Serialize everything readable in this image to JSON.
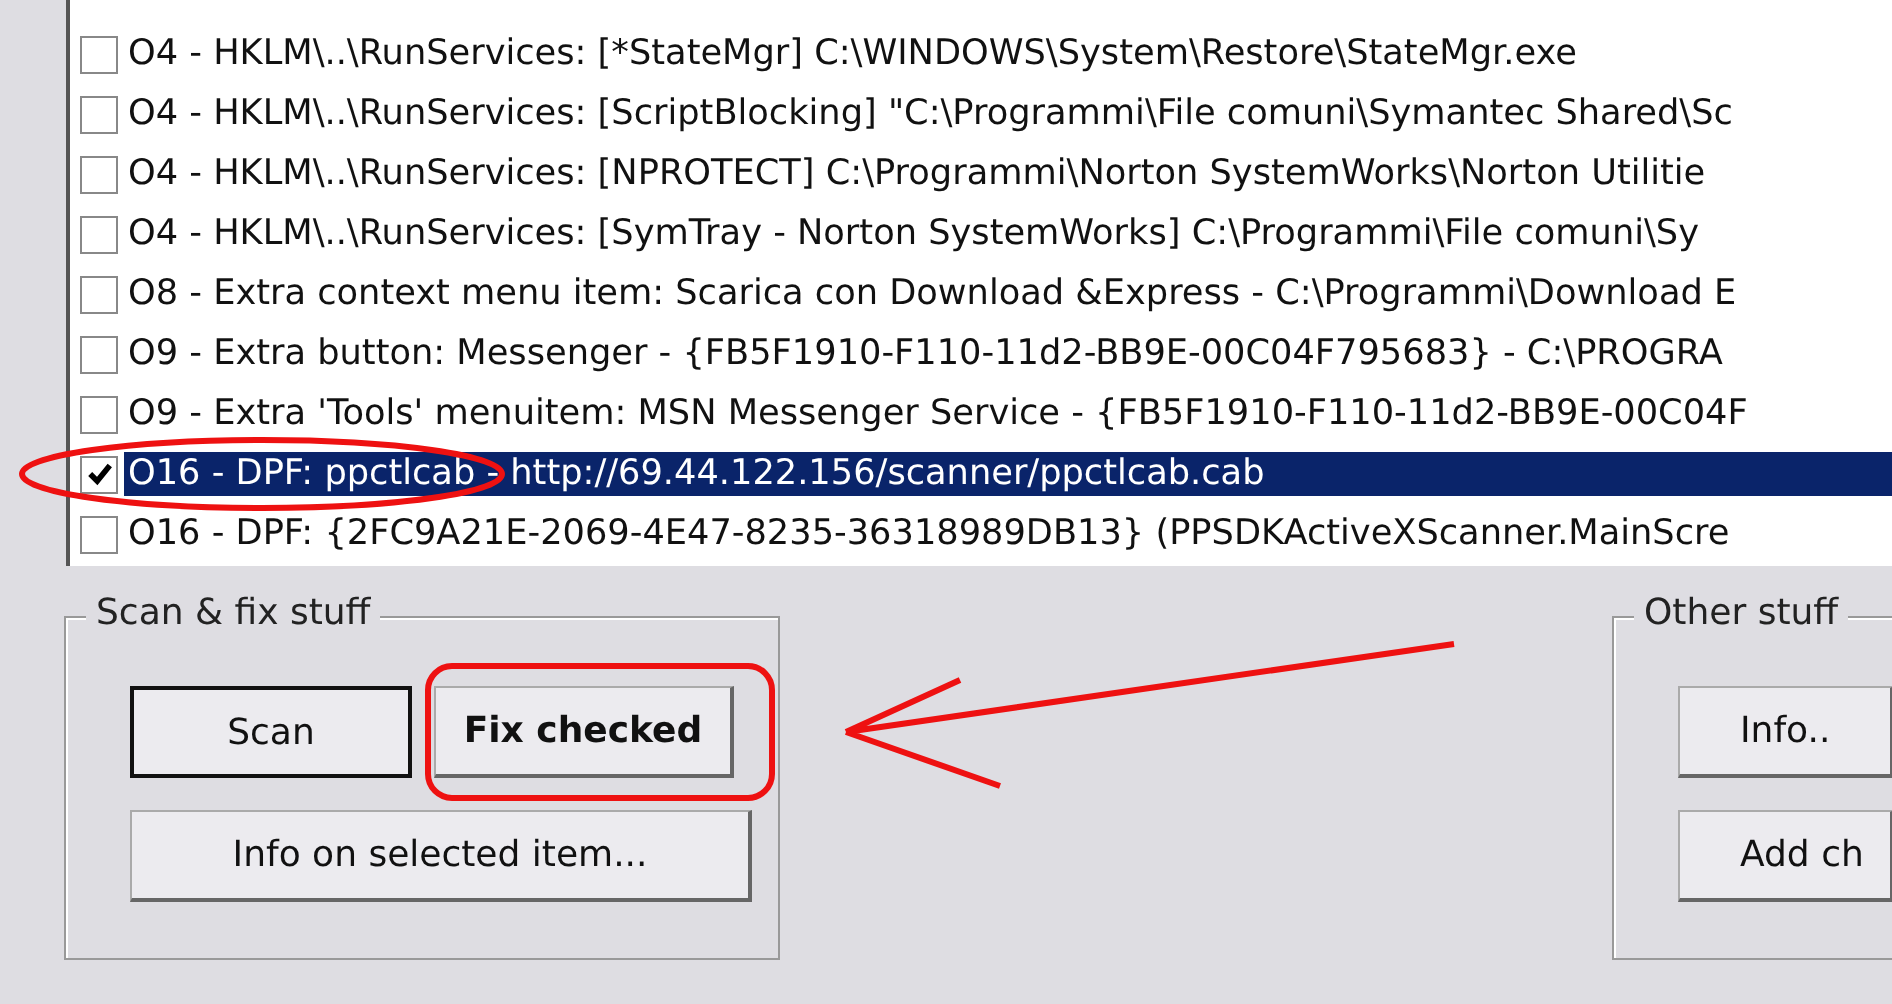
{
  "items": [
    {
      "text": "O4 - HKLM\\..\\RunServices: [*StateMgr] C:\\WINDOWS\\System\\Restore\\StateMgr.exe",
      "checked": false,
      "selected": false
    },
    {
      "text": "O4 - HKLM\\..\\RunServices: [ScriptBlocking] \"C:\\Programmi\\File comuni\\Symantec Shared\\Sc",
      "checked": false,
      "selected": false
    },
    {
      "text": "O4 - HKLM\\..\\RunServices: [NPROTECT] C:\\Programmi\\Norton SystemWorks\\Norton Utilitie",
      "checked": false,
      "selected": false
    },
    {
      "text": "O4 - HKLM\\..\\RunServices: [SymTray - Norton SystemWorks] C:\\Programmi\\File comuni\\Sy",
      "checked": false,
      "selected": false
    },
    {
      "text": "O8 - Extra context menu item: Scarica con Download &Express - C:\\Programmi\\Download E",
      "checked": false,
      "selected": false
    },
    {
      "text": "O9 - Extra button: Messenger - {FB5F1910-F110-11d2-BB9E-00C04F795683} - C:\\PROGRA",
      "checked": false,
      "selected": false
    },
    {
      "text": "O9 - Extra 'Tools' menuitem: MSN Messenger Service - {FB5F1910-F110-11d2-BB9E-00C04F",
      "checked": false,
      "selected": false
    },
    {
      "text": "O16 - DPF: ppctlcab - http://69.44.122.156/scanner/ppctlcab.cab",
      "checked": true,
      "selected": true
    },
    {
      "text": "O16 - DPF: {2FC9A21E-2069-4E47-8235-36318989DB13} (PPSDKActiveXScanner.MainScre",
      "checked": false,
      "selected": false
    }
  ],
  "groups": [
    {
      "label": "Scan & fix stuff",
      "buttons": [
        {
          "label": "Scan",
          "default": true,
          "bold": false
        },
        {
          "label": "Fix checked",
          "default": false,
          "bold": true
        },
        {
          "label": "Info on selected item...",
          "default": false,
          "bold": false
        }
      ]
    },
    {
      "label": "Other stuff",
      "buttons": [
        {
          "label": "Info..",
          "default": false,
          "bold": false
        },
        {
          "label": "Add ch",
          "default": false,
          "bold": false
        }
      ]
    }
  ],
  "annotations": [
    {
      "kind": "ellipse"
    },
    {
      "kind": "box"
    },
    {
      "kind": "arrow"
    }
  ]
}
